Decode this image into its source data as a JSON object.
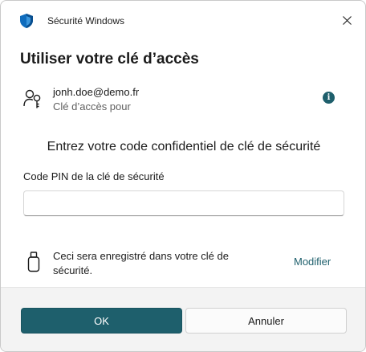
{
  "window": {
    "title": "Sécurité Windows",
    "icon": "windows-security-shield-icon",
    "close_icon": "close-icon"
  },
  "heading": "Utiliser votre clé d’accès",
  "account": {
    "icon": "key-user-icon",
    "email": "jonh.doe@demo.fr",
    "subtitle": "Clé d’accès pour",
    "info_icon": "info-icon",
    "info_glyph": "i"
  },
  "prompt": "Entrez votre code confidentiel de clé de sécurité",
  "pin": {
    "label": "Code PIN de la clé de sécurité",
    "value": "",
    "placeholder": ""
  },
  "storage": {
    "icon": "usb-key-icon",
    "text": "Ceci sera enregistré dans votre clé de sécurité.",
    "modify_label": "Modifier"
  },
  "footer": {
    "ok_label": "OK",
    "cancel_label": "Annuler"
  },
  "colors": {
    "accent": "#1e5f6c",
    "shield_blue": "#0f6cbd",
    "footer_bg": "#f3f3f3"
  }
}
